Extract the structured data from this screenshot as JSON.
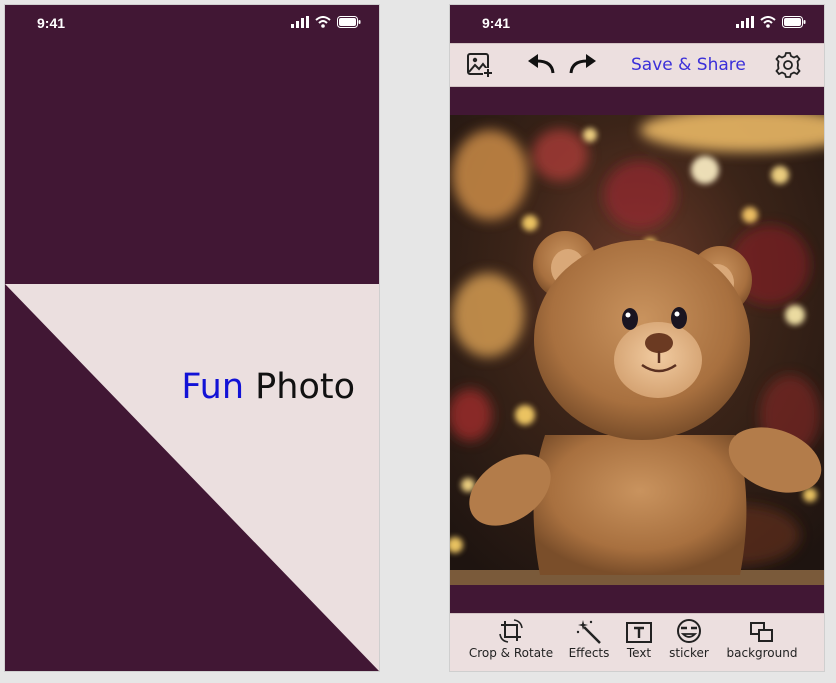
{
  "splash": {
    "status_time": "9:41",
    "brand_word_1": "Fun",
    "brand_word_2": "Photo",
    "colors": {
      "background": "#411734",
      "panel": "#ebdfdf",
      "accent": "#1212d6"
    }
  },
  "editor": {
    "status_time": "9:41",
    "toolbar": {
      "add_image_icon": "image-plus-icon",
      "undo_icon": "undo-icon",
      "redo_icon": "redo-icon",
      "save_share_label": "Save & Share",
      "settings_icon": "gear-icon"
    },
    "photo": {
      "subject": "teddy-bear-photo"
    },
    "bottom_nav": [
      {
        "label": "Crop & Rotate",
        "icon": "crop-rotate-icon"
      },
      {
        "label": "Effects",
        "icon": "magic-wand-icon"
      },
      {
        "label": "Text",
        "icon": "text-box-icon"
      },
      {
        "label": "sticker",
        "icon": "sticker-face-icon"
      },
      {
        "label": "background",
        "icon": "layers-icon"
      }
    ],
    "colors": {
      "frame": "#411734",
      "toolbar": "#ecdfdf",
      "save_text": "#3a2fd9"
    }
  }
}
